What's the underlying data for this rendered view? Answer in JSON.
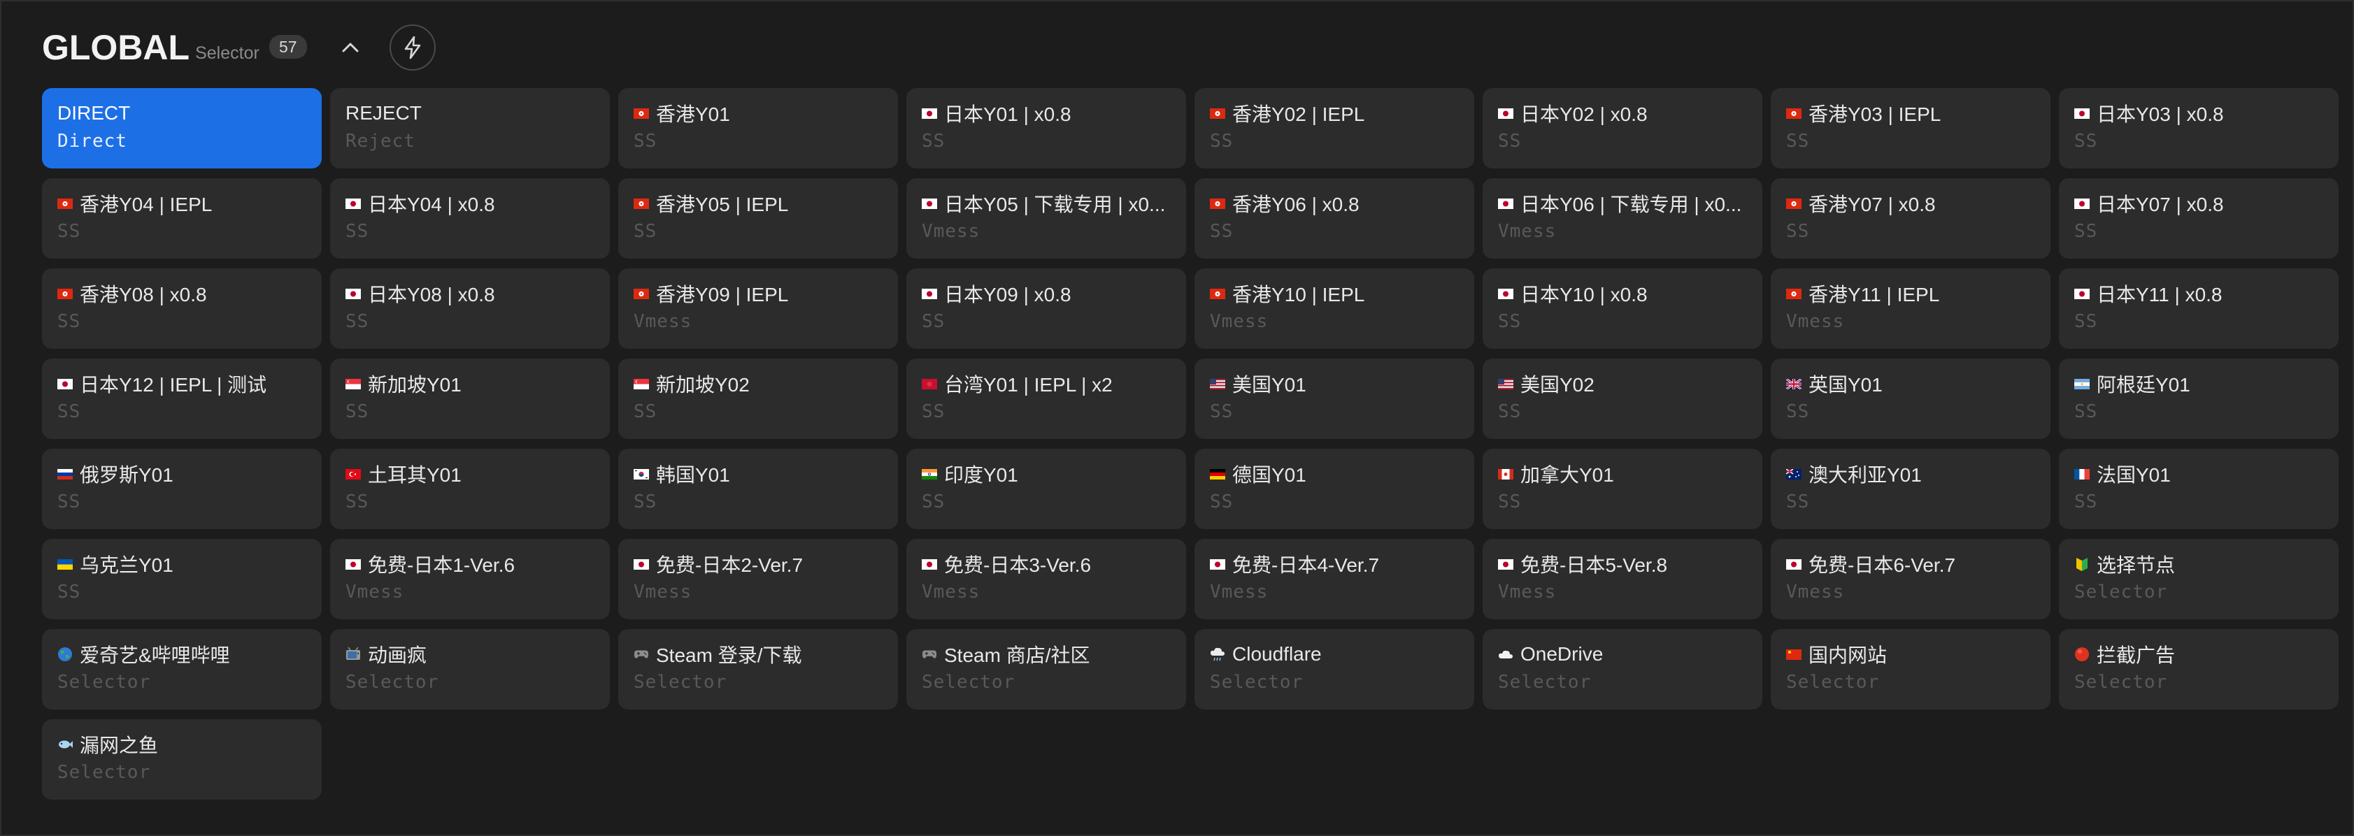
{
  "header": {
    "title": "GLOBAL",
    "subtitle": "Selector",
    "count": "57",
    "collapse_icon": "chevron-up-icon",
    "latency_icon": "lightning-bolt-icon"
  },
  "colors": {
    "background": "#1c1c1c",
    "card": "#2c2c2c",
    "selected": "#1d6fe6"
  },
  "proxies": [
    {
      "name": "DIRECT",
      "type": "Direct",
      "flag": "none",
      "selected": true
    },
    {
      "name": "REJECT",
      "type": "Reject",
      "flag": "none"
    },
    {
      "name": "香港Y01",
      "type": "SS",
      "flag": "hk-flag"
    },
    {
      "name": "日本Y01 | x0.8",
      "type": "SS",
      "flag": "jp-flag"
    },
    {
      "name": "香港Y02 | IEPL",
      "type": "SS",
      "flag": "hk-flag"
    },
    {
      "name": "日本Y02 | x0.8",
      "type": "SS",
      "flag": "jp-flag"
    },
    {
      "name": "香港Y03 | IEPL",
      "type": "SS",
      "flag": "hk-flag"
    },
    {
      "name": "日本Y03 | x0.8",
      "type": "SS",
      "flag": "jp-flag"
    },
    {
      "name": "香港Y04 | IEPL",
      "type": "SS",
      "flag": "hk-flag"
    },
    {
      "name": "日本Y04 | x0.8",
      "type": "SS",
      "flag": "jp-flag"
    },
    {
      "name": "香港Y05 | IEPL",
      "type": "SS",
      "flag": "hk-flag"
    },
    {
      "name": "日本Y05 | 下载专用 | x0...",
      "type": "Vmess",
      "flag": "jp-flag"
    },
    {
      "name": "香港Y06 | x0.8",
      "type": "SS",
      "flag": "hk-flag"
    },
    {
      "name": "日本Y06 | 下载专用 | x0...",
      "type": "Vmess",
      "flag": "jp-flag"
    },
    {
      "name": "香港Y07 | x0.8",
      "type": "SS",
      "flag": "hk-flag"
    },
    {
      "name": "日本Y07 | x0.8",
      "type": "SS",
      "flag": "jp-flag"
    },
    {
      "name": "香港Y08 | x0.8",
      "type": "SS",
      "flag": "hk-flag"
    },
    {
      "name": "日本Y08 | x0.8",
      "type": "SS",
      "flag": "jp-flag"
    },
    {
      "name": "香港Y09 | IEPL",
      "type": "Vmess",
      "flag": "hk-flag"
    },
    {
      "name": "日本Y09 | x0.8",
      "type": "SS",
      "flag": "jp-flag"
    },
    {
      "name": "香港Y10 | IEPL",
      "type": "Vmess",
      "flag": "hk-flag"
    },
    {
      "name": "日本Y10 | x0.8",
      "type": "SS",
      "flag": "jp-flag"
    },
    {
      "name": "香港Y11 | IEPL",
      "type": "Vmess",
      "flag": "hk-flag"
    },
    {
      "name": "日本Y11 | x0.8",
      "type": "SS",
      "flag": "jp-flag"
    },
    {
      "name": "日本Y12 | IEPL | 测试",
      "type": "SS",
      "flag": "jp-flag"
    },
    {
      "name": "新加坡Y01",
      "type": "SS",
      "flag": "sg-flag"
    },
    {
      "name": "新加坡Y02",
      "type": "SS",
      "flag": "sg-flag"
    },
    {
      "name": "台湾Y01 | IEPL | x2",
      "type": "SS",
      "flag": "tw-flag"
    },
    {
      "name": "美国Y01",
      "type": "SS",
      "flag": "us-flag"
    },
    {
      "name": "美国Y02",
      "type": "SS",
      "flag": "us-flag"
    },
    {
      "name": "英国Y01",
      "type": "SS",
      "flag": "gb-flag"
    },
    {
      "name": "阿根廷Y01",
      "type": "SS",
      "flag": "ar-flag"
    },
    {
      "name": "俄罗斯Y01",
      "type": "SS",
      "flag": "ru-flag"
    },
    {
      "name": "土耳其Y01",
      "type": "SS",
      "flag": "tr-flag"
    },
    {
      "name": "韩国Y01",
      "type": "SS",
      "flag": "kr-flag"
    },
    {
      "name": "印度Y01",
      "type": "SS",
      "flag": "in-flag"
    },
    {
      "name": "德国Y01",
      "type": "SS",
      "flag": "de-flag"
    },
    {
      "name": "加拿大Y01",
      "type": "SS",
      "flag": "ca-flag"
    },
    {
      "name": "澳大利亚Y01",
      "type": "SS",
      "flag": "au-flag"
    },
    {
      "name": "法国Y01",
      "type": "SS",
      "flag": "fr-flag"
    },
    {
      "name": "乌克兰Y01",
      "type": "SS",
      "flag": "ua-flag"
    },
    {
      "name": "免费-日本1-Ver.6",
      "type": "Vmess",
      "flag": "jp-flag"
    },
    {
      "name": "免费-日本2-Ver.7",
      "type": "Vmess",
      "flag": "jp-flag"
    },
    {
      "name": "免费-日本3-Ver.6",
      "type": "Vmess",
      "flag": "jp-flag"
    },
    {
      "name": "免费-日本4-Ver.7",
      "type": "Vmess",
      "flag": "jp-flag"
    },
    {
      "name": "免费-日本5-Ver.8",
      "type": "Vmess",
      "flag": "jp-flag"
    },
    {
      "name": "免费-日本6-Ver.7",
      "type": "Vmess",
      "flag": "jp-flag"
    },
    {
      "name": "选择节点",
      "type": "Selector",
      "flag": "beginner-icon"
    },
    {
      "name": "爱奇艺&哔哩哔哩",
      "type": "Selector",
      "flag": "globe-icon"
    },
    {
      "name": "动画疯",
      "type": "Selector",
      "flag": "tv-icon"
    },
    {
      "name": "Steam 登录/下载",
      "type": "Selector",
      "flag": "gamepad-icon"
    },
    {
      "name": "Steam 商店/社区",
      "type": "Selector",
      "flag": "gamepad-icon"
    },
    {
      "name": "Cloudflare",
      "type": "Selector",
      "flag": "cloud-rain-icon"
    },
    {
      "name": "OneDrive",
      "type": "Selector",
      "flag": "cloud-icon"
    },
    {
      "name": "国内网站",
      "type": "Selector",
      "flag": "cn-flag"
    },
    {
      "name": "拦截广告",
      "type": "Selector",
      "flag": "red-circle-icon"
    },
    {
      "name": "漏网之鱼",
      "type": "Selector",
      "flag": "fish-icon"
    }
  ]
}
